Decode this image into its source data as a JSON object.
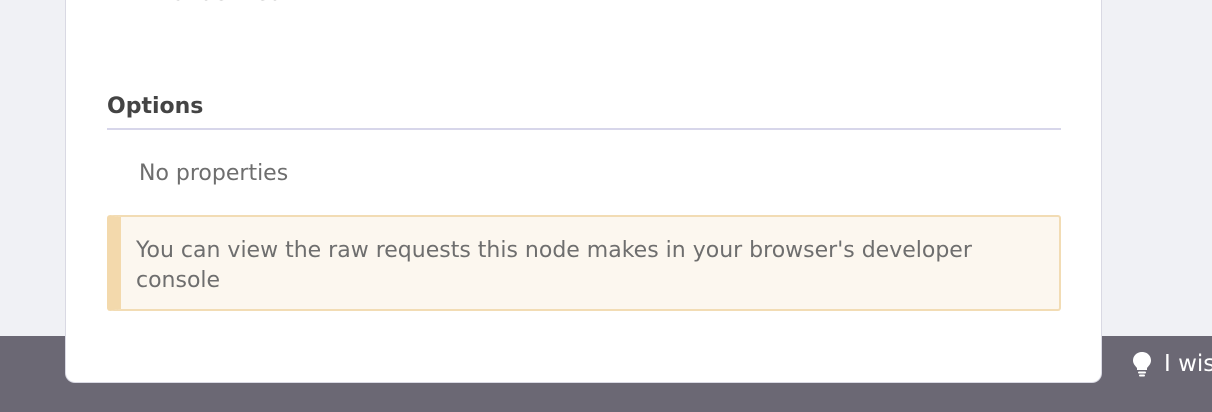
{
  "panel": {
    "previous_value": "undefined",
    "options_heading": "Options",
    "empty_text": "No properties",
    "notice_text": "You can view the raw requests this node makes in your browser's developer console"
  },
  "bottom_bar": {
    "tip_text": "I wis",
    "tip_icon": "lightbulb-icon"
  },
  "colors": {
    "bottom_bar": "#6b6874",
    "notice_bg": "#fcf7ef",
    "notice_border": "#f3d9ac",
    "section_rule": "#d7d6ea"
  }
}
